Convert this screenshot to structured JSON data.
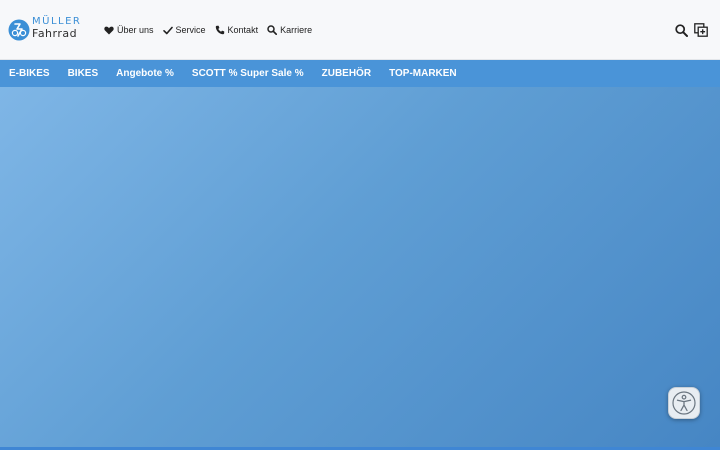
{
  "brand": {
    "line1": "MÜLLER",
    "line2": "Fahrrad",
    "accent_color": "#3b8fd6"
  },
  "utility_nav": [
    {
      "label": "Über uns",
      "icon": "heart-icon"
    },
    {
      "label": "Service",
      "icon": "check-icon"
    },
    {
      "label": "Kontakt",
      "icon": "phone-icon"
    },
    {
      "label": "Karriere",
      "icon": "search-icon"
    }
  ],
  "tools": [
    {
      "icon": "search-icon"
    },
    {
      "icon": "compare-add-icon"
    }
  ],
  "main_nav": {
    "background": "#4a94d8",
    "items": [
      "E-BIKES",
      "BIKES",
      "Angebote %",
      "SCOTT % Super Sale %",
      "ZUBEHÖR",
      "TOP-MARKEN"
    ]
  },
  "hero": {
    "gradient_from": "#7fb6e6",
    "gradient_to": "#4686c4"
  },
  "accessibility_button": {
    "icon": "accessibility-icon"
  }
}
